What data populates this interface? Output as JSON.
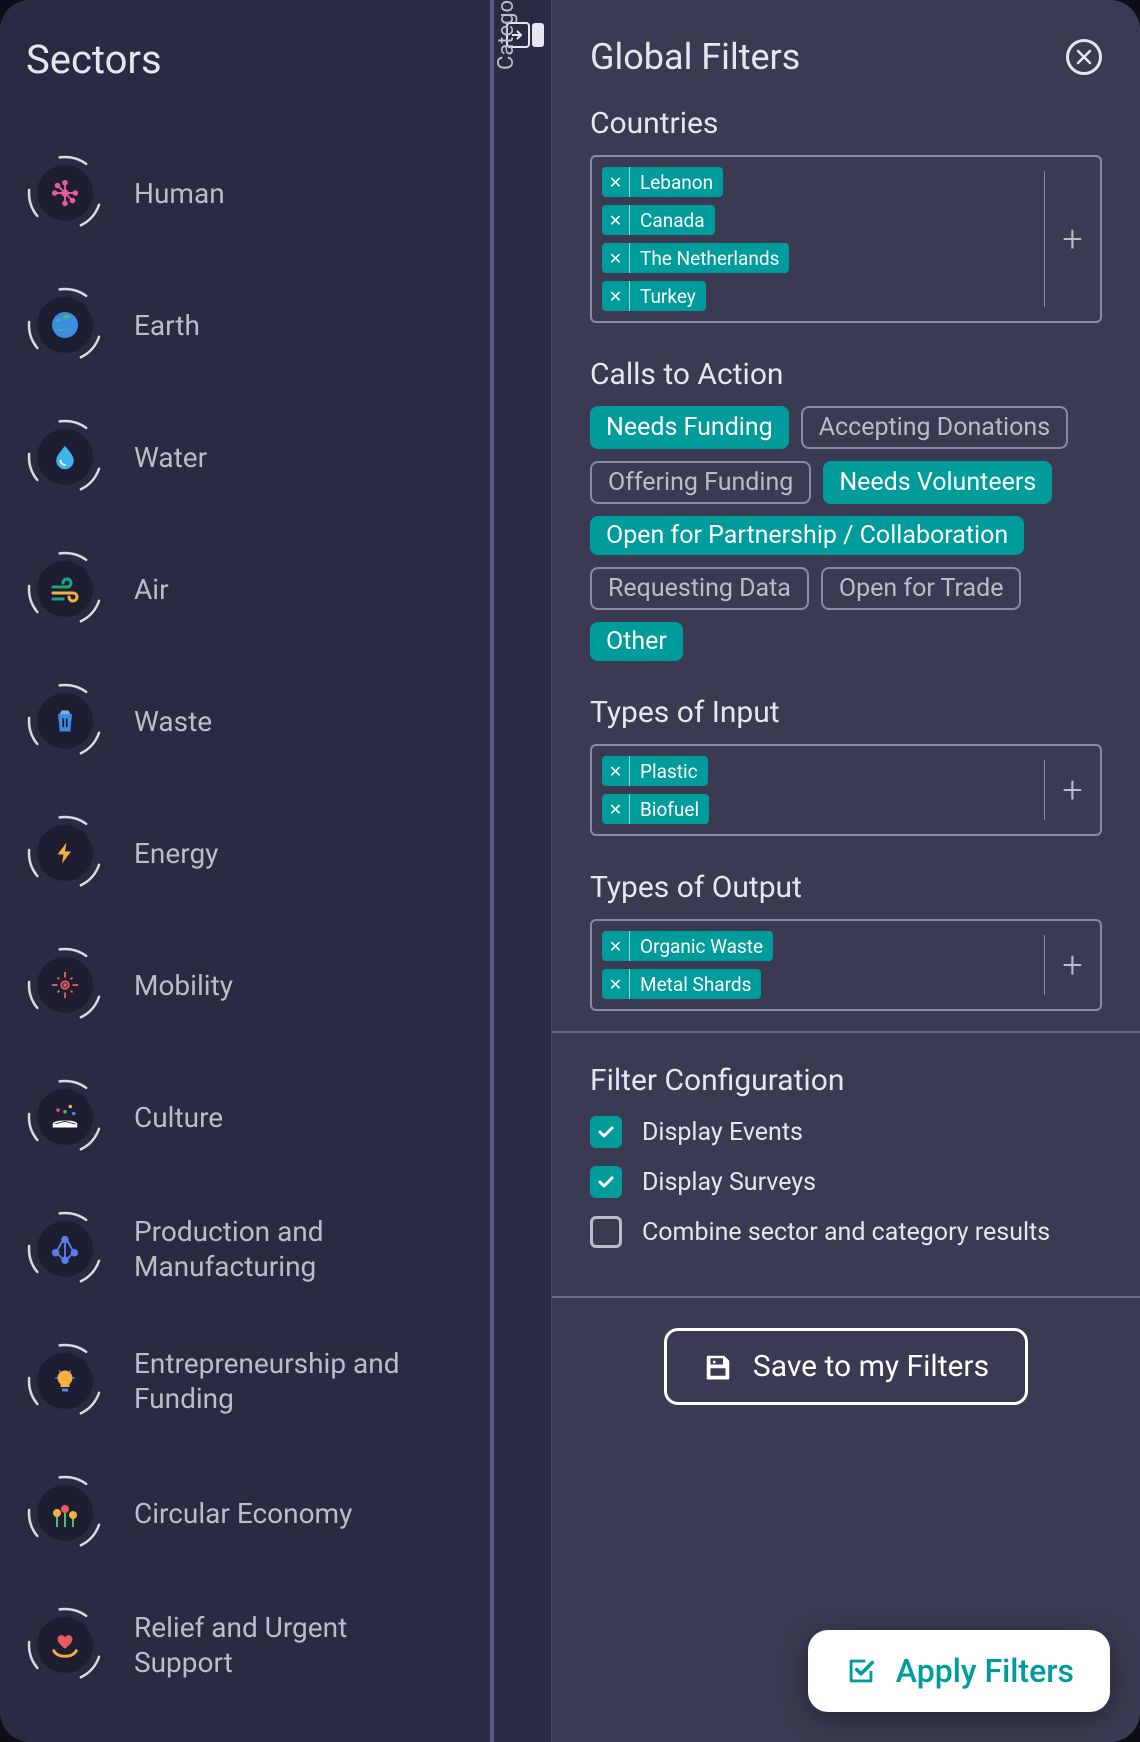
{
  "sectors": {
    "title": "Sectors",
    "items": [
      {
        "label": "Human",
        "icon": "neuron"
      },
      {
        "label": "Earth",
        "icon": "globe"
      },
      {
        "label": "Water",
        "icon": "drop"
      },
      {
        "label": "Air",
        "icon": "wind"
      },
      {
        "label": "Waste",
        "icon": "trash"
      },
      {
        "label": "Energy",
        "icon": "bolt"
      },
      {
        "label": "Mobility",
        "icon": "mobility"
      },
      {
        "label": "Culture",
        "icon": "book"
      },
      {
        "label": "Production and Manufacturing",
        "icon": "nodes"
      },
      {
        "label": "Entrepreneurship and Funding",
        "icon": "bulb"
      },
      {
        "label": "Circular Economy",
        "icon": "flowers"
      },
      {
        "label": "Relief and Urgent Support",
        "icon": "heart-hands"
      }
    ]
  },
  "strip": {
    "categories_label": "Categories"
  },
  "filters": {
    "title": "Global Filters",
    "countries": {
      "title": "Countries",
      "tags": [
        "Lebanon",
        "Canada",
        "The Netherlands",
        "Turkey"
      ]
    },
    "calls_to_action": {
      "title": "Calls to Action",
      "pills": [
        {
          "label": "Needs Funding",
          "active": true
        },
        {
          "label": "Accepting Donations",
          "active": false
        },
        {
          "label": "Offering Funding",
          "active": false
        },
        {
          "label": "Needs Volunteers",
          "active": true
        },
        {
          "label": "Open for Partnership / Collaboration",
          "active": true
        },
        {
          "label": "Requesting Data",
          "active": false
        },
        {
          "label": "Open for Trade",
          "active": false
        },
        {
          "label": "Other",
          "active": true
        }
      ]
    },
    "types_of_input": {
      "title": "Types of Input",
      "tags": [
        "Plastic",
        "Biofuel"
      ]
    },
    "types_of_output": {
      "title": "Types of Output",
      "tags": [
        "Organic Waste",
        "Metal Shards"
      ]
    },
    "config": {
      "title": "Filter Configuration",
      "checks": [
        {
          "label": "Display Events",
          "checked": true
        },
        {
          "label": "Display Surveys",
          "checked": true
        },
        {
          "label": "Combine sector and category results",
          "checked": false
        }
      ]
    },
    "save_label": "Save to my Filters",
    "apply_label": "Apply Filters"
  }
}
